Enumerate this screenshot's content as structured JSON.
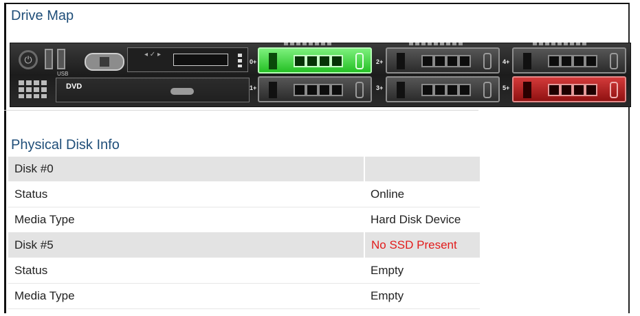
{
  "drive_map": {
    "title": "Drive Map",
    "usb_label": "USB",
    "dvd_label": "DVD",
    "bays": [
      {
        "slot": "0",
        "label": "0+",
        "state": "online",
        "color": "#3fd83f"
      },
      {
        "slot": "1",
        "label": "1+",
        "state": "normal"
      },
      {
        "slot": "2",
        "label": "2+",
        "state": "normal"
      },
      {
        "slot": "3",
        "label": "3+",
        "state": "normal"
      },
      {
        "slot": "4",
        "label": "4+",
        "state": "normal"
      },
      {
        "slot": "5",
        "label": "5+",
        "state": "alert",
        "color": "#c62020"
      }
    ]
  },
  "disk_info": {
    "title": "Physical Disk Info",
    "groups": [
      {
        "header": "Disk #0",
        "header_value": "",
        "rows": [
          {
            "label": "Status",
            "value": "Online"
          },
          {
            "label": "Media Type",
            "value": "Hard Disk Device"
          }
        ]
      },
      {
        "header": "Disk #5",
        "header_value": "No SSD Present",
        "header_value_color": "#e21b1b",
        "rows": [
          {
            "label": "Status",
            "value": "Empty"
          },
          {
            "label": "Media Type",
            "value": "Empty"
          }
        ]
      }
    ]
  }
}
